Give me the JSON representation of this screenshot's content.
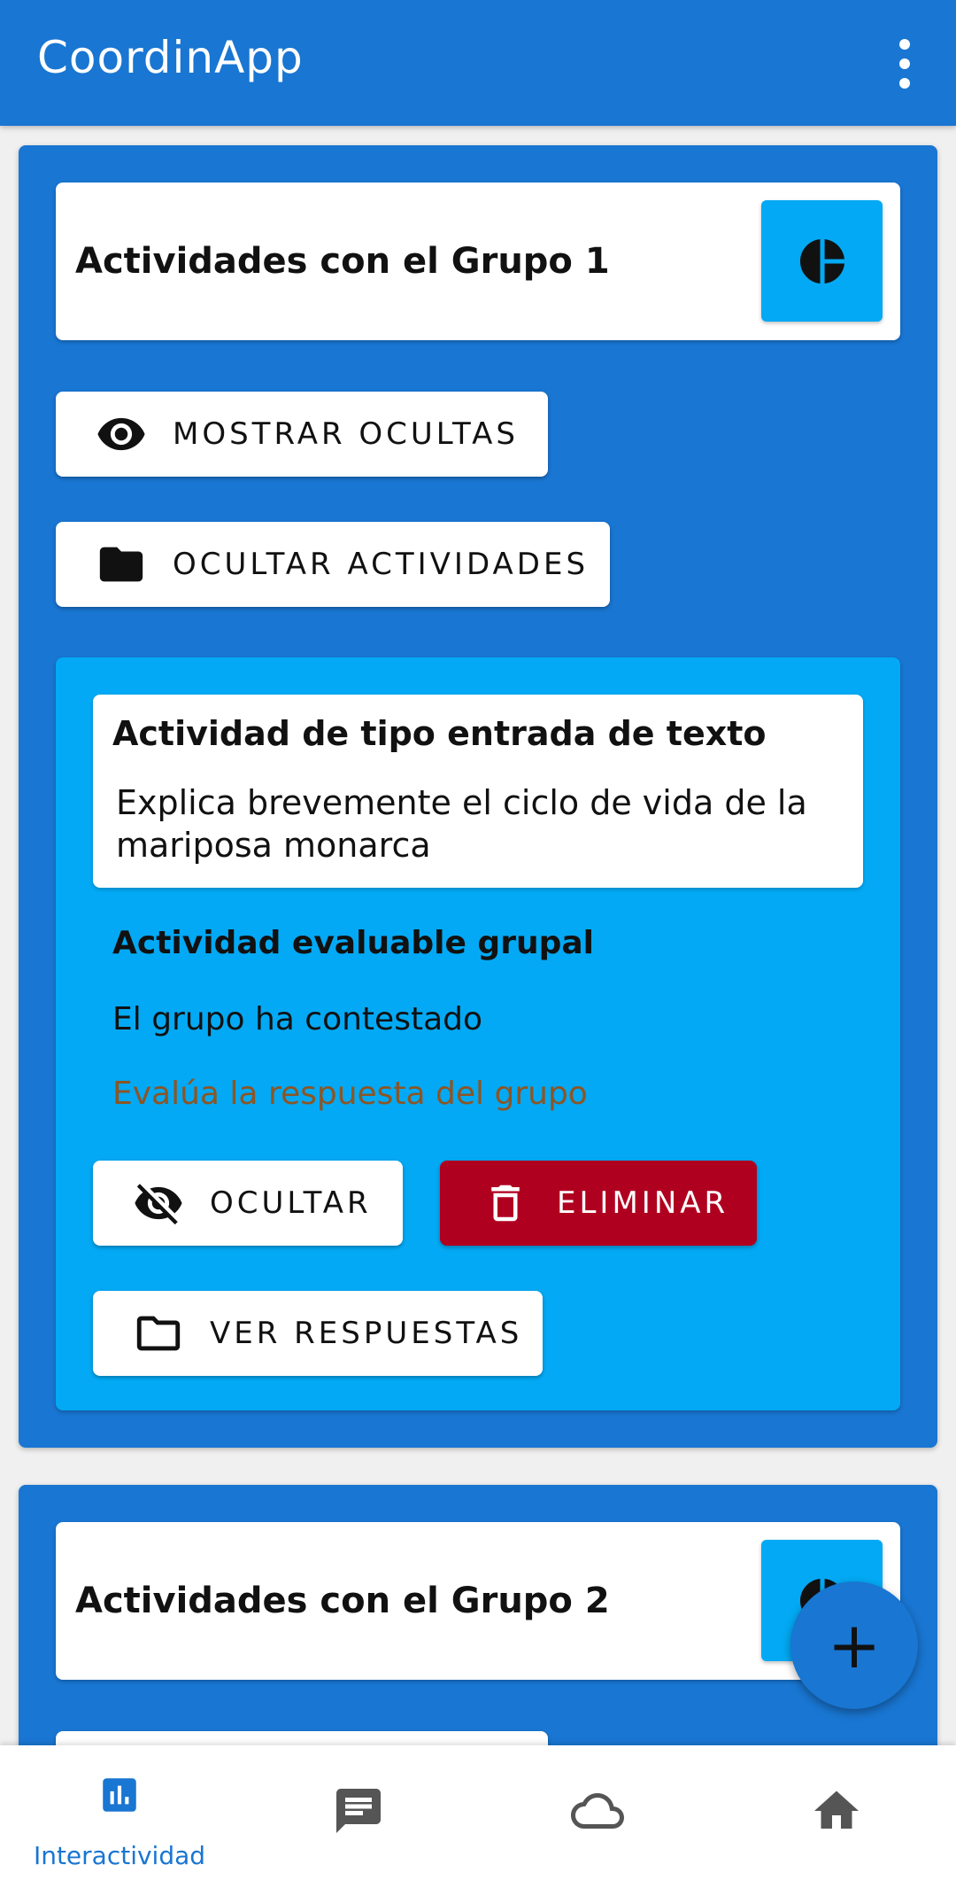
{
  "app": {
    "title": "CoordinApp",
    "menu_icon": "more-vert-icon"
  },
  "groups": [
    {
      "title": "Actividades con el Grupo 1",
      "buttons": {
        "show_hidden": "MOSTRAR OCULTAS",
        "hide_activities": "OCULTAR ACTIVIDADES"
      },
      "activity": {
        "title": "Actividad de tipo entrada de texto",
        "description": "Explica brevemente el ciclo de vida de la mariposa monarca",
        "type": "Actividad evaluable grupal",
        "status": "El grupo ha contestado",
        "evaluate_link": "Evalúa la respuesta del grupo",
        "buttons": {
          "hide": "OCULTAR",
          "delete": "ELIMINAR",
          "view_answers": "VER RESPUESTAS"
        }
      }
    },
    {
      "title": "Actividades con el Grupo 2"
    }
  ],
  "bottom_nav": [
    {
      "label": "Interactividad",
      "icon": "bar-chart-icon",
      "active": true
    },
    {
      "label": "",
      "icon": "chat-icon",
      "active": false
    },
    {
      "label": "",
      "icon": "cloud-icon",
      "active": false
    },
    {
      "label": "",
      "icon": "home-icon",
      "active": false
    }
  ],
  "fab": {
    "icon": "plus-icon",
    "label": "+"
  },
  "colors": {
    "primary": "#1976d2",
    "accent": "#03a9f4",
    "danger": "#b00020",
    "link": "#8d5524"
  }
}
